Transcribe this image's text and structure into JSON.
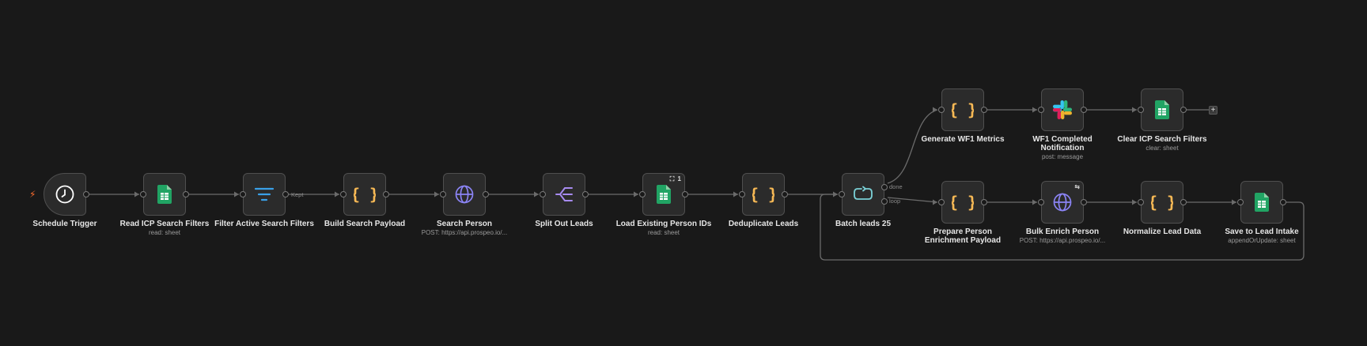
{
  "workflow": {
    "nodes": [
      {
        "id": "schedule-trigger",
        "title": "Schedule Trigger",
        "subtitle": "",
        "icon": "clock-icon"
      },
      {
        "id": "read-icp-search-filters",
        "title": "Read ICP Search Filters",
        "subtitle": "read: sheet",
        "icon": "google-sheets-icon"
      },
      {
        "id": "filter-active-search-filters",
        "title": "Filter Active Search Filters",
        "subtitle": "",
        "icon": "filter-icon"
      },
      {
        "id": "build-search-payload",
        "title": "Build Search Payload",
        "subtitle": "",
        "icon": "code-braces-icon"
      },
      {
        "id": "search-person",
        "title": "Search Person",
        "subtitle": "POST: https://api.prospeo.io/...",
        "icon": "globe-icon"
      },
      {
        "id": "split-out-leads",
        "title": "Split Out Leads",
        "subtitle": "",
        "icon": "split-icon"
      },
      {
        "id": "load-existing-person-ids",
        "title": "Load Existing Person IDs",
        "subtitle": "read: sheet",
        "icon": "google-sheets-icon",
        "badge": "1"
      },
      {
        "id": "deduplicate-leads",
        "title": "Deduplicate Leads",
        "subtitle": "",
        "icon": "code-braces-icon"
      },
      {
        "id": "batch-leads-25",
        "title": "Batch leads 25",
        "subtitle": "",
        "icon": "loop-icon"
      },
      {
        "id": "generate-wf1-metrics",
        "title": "Generate WF1 Metrics",
        "subtitle": "",
        "icon": "code-braces-icon"
      },
      {
        "id": "wf1-completed-notification",
        "title": "WF1 Completed Notification",
        "subtitle": "post: message",
        "icon": "slack-icon"
      },
      {
        "id": "clear-icp-search-filters",
        "title": "Clear ICP Search Filters",
        "subtitle": "clear: sheet",
        "icon": "google-sheets-icon"
      },
      {
        "id": "prepare-person-enrichment-payload",
        "title": "Prepare Person Enrichment Payload",
        "subtitle": "",
        "icon": "code-braces-icon"
      },
      {
        "id": "bulk-enrich-person",
        "title": "Bulk Enrich Person",
        "subtitle": "POST: https://api.prospeo.io/...",
        "icon": "globe-icon"
      },
      {
        "id": "normalize-lead-data",
        "title": "Normalize Lead Data",
        "subtitle": "",
        "icon": "code-braces-icon"
      },
      {
        "id": "save-to-lead-intake",
        "title": "Save to Lead Intake",
        "subtitle": "appendOrUpdate: sheet",
        "icon": "google-sheets-icon"
      }
    ],
    "edge_labels": {
      "kept": "Kept",
      "done": "done",
      "loop": "loop"
    },
    "colors": {
      "background": "#191919",
      "node_fill": "#2b2b2b",
      "node_border": "#4f4f4f",
      "wire": "#6b6b6b",
      "code_icon": "#f7b955",
      "filter_icon": "#3aa0e8",
      "globe_icon": "#8b84f5",
      "split_icon": "#a78bf0",
      "loop_icon": "#7ad0d6",
      "sheets_green": "#21a464",
      "trigger_bolt": "#ff6d2d"
    }
  }
}
